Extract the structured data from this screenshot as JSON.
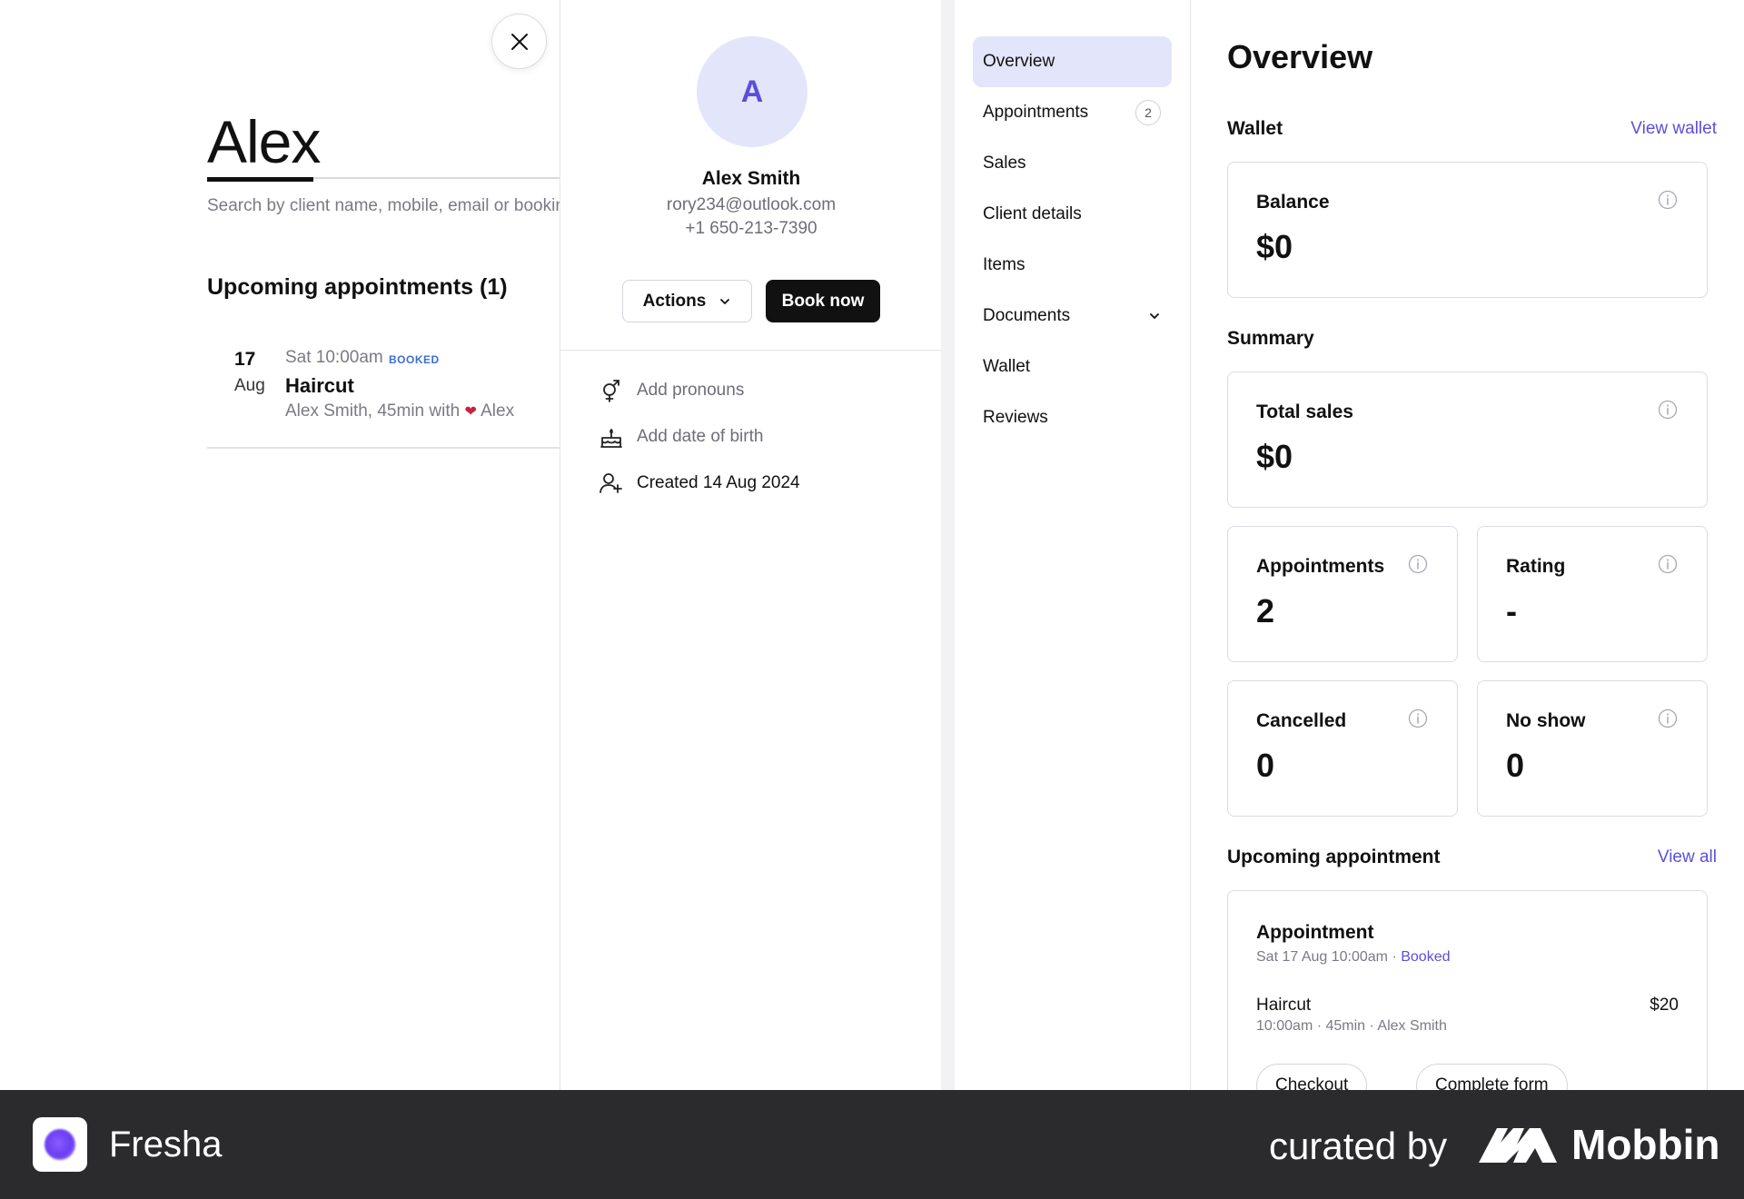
{
  "background": {
    "search_title": "Alex",
    "search_hint": "Search by client name, mobile, email or booking reference",
    "upcoming_heading": "Upcoming appointments (1)",
    "appointment": {
      "day": "17",
      "month": "Aug",
      "time": "Sat 10:00am",
      "status": "BOOKED",
      "service": "Haircut",
      "detail_prefix": "Alex Smith, 45min with",
      "staff": "Alex"
    }
  },
  "close_icon": "close-icon",
  "profile": {
    "initial": "A",
    "name": "Alex Smith",
    "email": "rory234@outlook.com",
    "phone": "+1 650-213-7390",
    "actions_label": "Actions",
    "book_label": "Book now",
    "pronouns_label": "Add pronouns",
    "dob_label": "Add date of birth",
    "created_label": "Created 14 Aug 2024"
  },
  "nav": {
    "items": [
      {
        "label": "Overview"
      },
      {
        "label": "Appointments",
        "badge": "2"
      },
      {
        "label": "Sales"
      },
      {
        "label": "Client details"
      },
      {
        "label": "Items"
      },
      {
        "label": "Documents"
      },
      {
        "label": "Wallet"
      },
      {
        "label": "Reviews"
      }
    ]
  },
  "overview": {
    "title": "Overview",
    "wallet_heading": "Wallet",
    "view_wallet": "View wallet",
    "balance_label": "Balance",
    "balance_value": "$0",
    "summary_heading": "Summary",
    "total_sales_label": "Total sales",
    "total_sales_value": "$0",
    "appointments_label": "Appointments",
    "appointments_value": "2",
    "rating_label": "Rating",
    "rating_value": "-",
    "cancelled_label": "Cancelled",
    "cancelled_value": "0",
    "no_show_label": "No show",
    "no_show_value": "0",
    "upcoming_heading": "Upcoming appointment",
    "view_all": "View all",
    "appointment_card": {
      "title": "Appointment",
      "date": "Sat 17 Aug 10:00am",
      "status": "Booked",
      "service": "Haircut",
      "price": "$20",
      "time": "10:00am",
      "duration": "45min",
      "staff": "Alex Smith",
      "checkout_label": "Checkout",
      "form_label": "Complete form"
    }
  },
  "footer": {
    "brand": "Fresha",
    "curated_by": "curated by",
    "mobbin": "Mobbin"
  },
  "colors": {
    "accent": "#5b4fd8",
    "accent_light": "#e3e5fb",
    "dark": "#111111",
    "footer_bg": "#2b2b2d"
  }
}
